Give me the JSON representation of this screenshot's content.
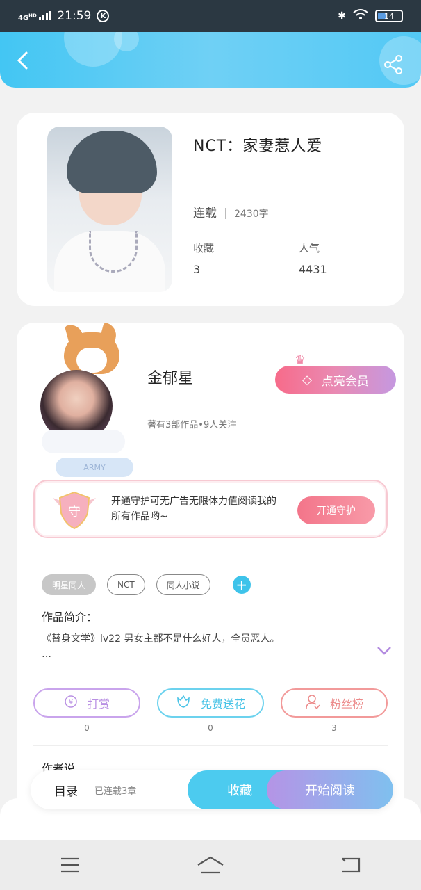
{
  "status_bar": {
    "network": "4G",
    "network_sup": "HD",
    "time": "21:59",
    "k_badge": "K",
    "battery": "14"
  },
  "header": {
    "back_icon": "chevron-left-icon",
    "share_icon": "share-icon"
  },
  "book": {
    "title": "NCT：家妻惹人爱",
    "status": "连载",
    "word_count": "2430字",
    "favorites_label": "收藏",
    "favorites_value": "3",
    "popularity_label": "人气",
    "popularity_value": "4431"
  },
  "author": {
    "name": "金郁星",
    "stats": "著有3部作品•9人关注",
    "badge": "ARMY",
    "vip_button": "点亮会员"
  },
  "guard": {
    "shield_char": "守",
    "text": "开通守护可无广告无限体力值阅读我的所有作品哟~",
    "button": "开通守护"
  },
  "tags": [
    "明星同人",
    "NCT",
    "同人小说"
  ],
  "intro": {
    "heading": "作品简介：",
    "text": "《替身文学》lv22 男女主都不是什么好人，全员恶人。\n…"
  },
  "actions": {
    "reward": "打赏",
    "reward_count": "0",
    "flower": "免费送花",
    "flower_count": "0",
    "fans": "粉丝榜",
    "fans_count": "3"
  },
  "author_says": "作者说",
  "bottom_bar": {
    "toc": "目录",
    "toc_sub": "已连载3章",
    "favorite": "收藏",
    "read": "开始阅读"
  },
  "colors": {
    "header_blue": "#43c6f3",
    "accent_cyan": "#4ccbef",
    "vip_pink": "#f76b8a",
    "purple": "#b594e6"
  }
}
